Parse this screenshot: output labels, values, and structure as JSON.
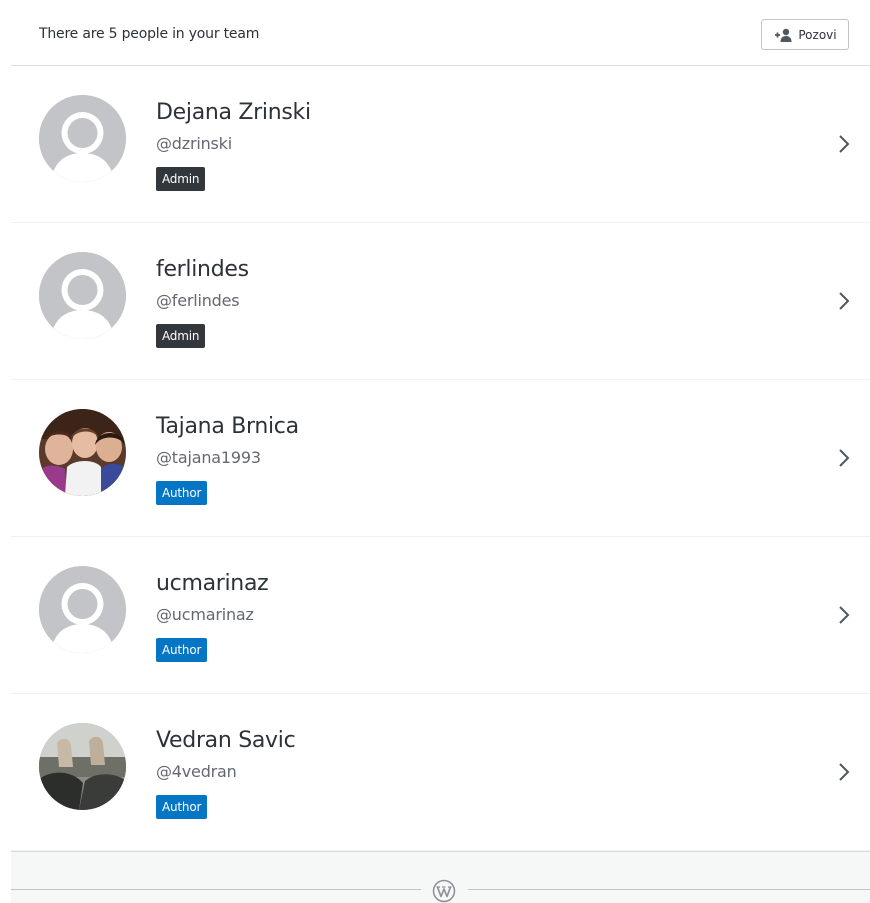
{
  "header": {
    "team_count_text": "There are 5 people in your team",
    "invite_label": "Pozovi",
    "invite_icon": "add-user-icon"
  },
  "members": [
    {
      "name": "Dejana Zrinski",
      "username": "@dzrinski",
      "role": "Admin",
      "avatar": "default-avatar"
    },
    {
      "name": "ferlindes",
      "username": "@ferlindes",
      "role": "Admin",
      "avatar": "default-avatar"
    },
    {
      "name": "Tajana Brnica",
      "username": "@tajana1993",
      "role": "Author",
      "avatar": "photo-group"
    },
    {
      "name": "ucmarinaz",
      "username": "@ucmarinaz",
      "role": "Author",
      "avatar": "default-avatar"
    },
    {
      "name": "Vedran Savic",
      "username": "@4vedran",
      "role": "Author",
      "avatar": "photo-feet"
    }
  ],
  "colors": {
    "admin_badge": "#32373c",
    "author_badge": "#0675c4",
    "default_avatar_bg": "#c3c4c7"
  },
  "footer": {
    "logo_icon": "wordpress-logo-icon"
  }
}
